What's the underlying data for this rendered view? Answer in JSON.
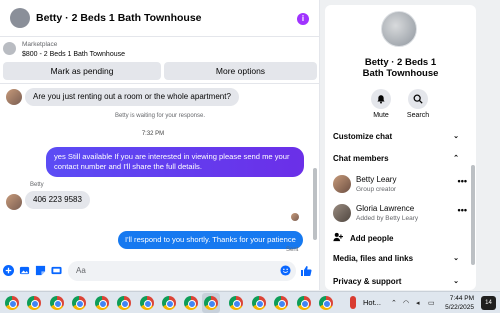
{
  "header": {
    "title": "Betty · 2 Beds 1 Bath Townhouse",
    "info_icon": "info-icon"
  },
  "marketplace": {
    "label": "Marketplace",
    "listing": "$800 - 2 Beds 1 Bath Townhouse"
  },
  "actions": {
    "mark_pending": "Mark as pending",
    "more_options": "More options"
  },
  "messages": {
    "incoming_1": "Are you just renting out a room or the whole apartment?",
    "waiting": "Betty is waiting for your response.",
    "time": "7:32 PM",
    "outgoing_1": "yes Still available If you are interested in viewing please send me your contact number and I'll share the full details.",
    "sender_name": "Betty",
    "incoming_2": "406 223 9583",
    "outgoing_2": "I'll respond to you shortly. Thanks for your patience",
    "sent_status": "Sent"
  },
  "composer": {
    "placeholder": "Aa"
  },
  "panel": {
    "name": "Betty · 2 Beds 1 Bath Townhouse",
    "mute": "Mute",
    "search": "Search",
    "customize": "Customize chat",
    "members_title": "Chat members",
    "members": [
      {
        "name": "Betty Leary",
        "role": "Group creator"
      },
      {
        "name": "Gloria Lawrence",
        "role": "Added by Betty Leary"
      }
    ],
    "add_people": "Add people",
    "media": "Media, files and links",
    "privacy": "Privacy & support"
  },
  "taskbar": {
    "weather": "Hot...",
    "time": "7:44 PM",
    "date": "5/22/2025",
    "badge": "14"
  },
  "colors": {
    "accent": "#0866ff",
    "outgoing_bubble": "#6b2fe8",
    "blue_bubble": "#1679f0"
  }
}
